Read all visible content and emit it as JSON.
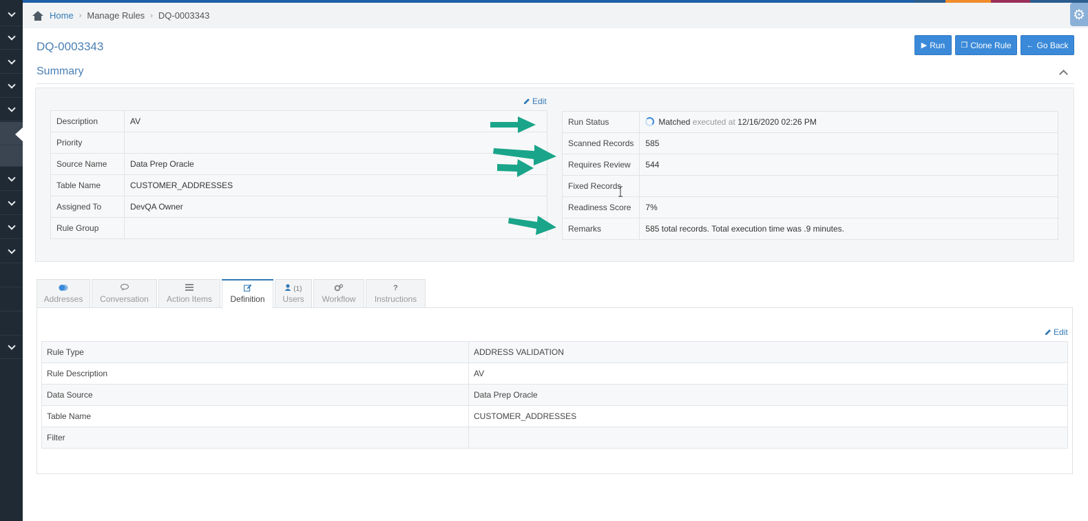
{
  "breadcrumb": {
    "home": "Home",
    "manage_rules": "Manage Rules",
    "current": "DQ-0003343"
  },
  "page": {
    "title": "DQ-0003343",
    "section_title": "Summary"
  },
  "toolbar": {
    "run_label": "Run",
    "clone_label": "Clone Rule",
    "back_label": "Go Back"
  },
  "summary": {
    "edit_label": "Edit",
    "left": [
      {
        "label": "Description",
        "value": "AV"
      },
      {
        "label": "Priority",
        "value": ""
      },
      {
        "label": "Source Name",
        "value": "Data Prep Oracle"
      },
      {
        "label": "Table Name",
        "value": "CUSTOMER_ADDRESSES"
      },
      {
        "label": "Assigned To",
        "value": "DevQA Owner"
      },
      {
        "label": "Rule Group",
        "value": ""
      }
    ],
    "run_status": {
      "label": "Run Status",
      "status": "Matched",
      "executed_text": "executed at",
      "timestamp": "12/16/2020 02:26 PM"
    },
    "right": [
      {
        "label": "Scanned Records",
        "value": "585"
      },
      {
        "label": "Requires Review",
        "value": "544"
      },
      {
        "label": "Fixed Records",
        "value": ""
      },
      {
        "label": "Readiness Score",
        "value": "7%"
      },
      {
        "label": "Remarks",
        "value": "585 total records. Total execution time was .9 minutes."
      }
    ]
  },
  "tabs": [
    {
      "label": "Addresses",
      "icon": "addresses-icon"
    },
    {
      "label": "Conversation",
      "icon": "chat-icon"
    },
    {
      "label": "Action Items",
      "icon": "list-icon"
    },
    {
      "label": "Definition",
      "icon": "edit-icon"
    },
    {
      "label": "Users",
      "icon": "user-icon",
      "count": "(1)"
    },
    {
      "label": "Workflow",
      "icon": "cogs-icon"
    },
    {
      "label": "Instructions",
      "icon": "question-icon",
      "glyph": "?"
    }
  ],
  "definition": {
    "edit_label": "Edit",
    "rows": [
      {
        "label": "Rule Type",
        "value": "ADDRESS VALIDATION"
      },
      {
        "label": "Rule Description",
        "value": "AV"
      },
      {
        "label": "Data Source",
        "value": "Data Prep Oracle"
      },
      {
        "label": "Table Name",
        "value": "CUSTOMER_ADDRESSES"
      },
      {
        "label": "Filter",
        "value": ""
      }
    ]
  },
  "colors": {
    "accent": "#337ab7",
    "button": "#3b8ad9",
    "sidebar": "#1f2a35",
    "annotation_arrow": "#1aa58a"
  }
}
